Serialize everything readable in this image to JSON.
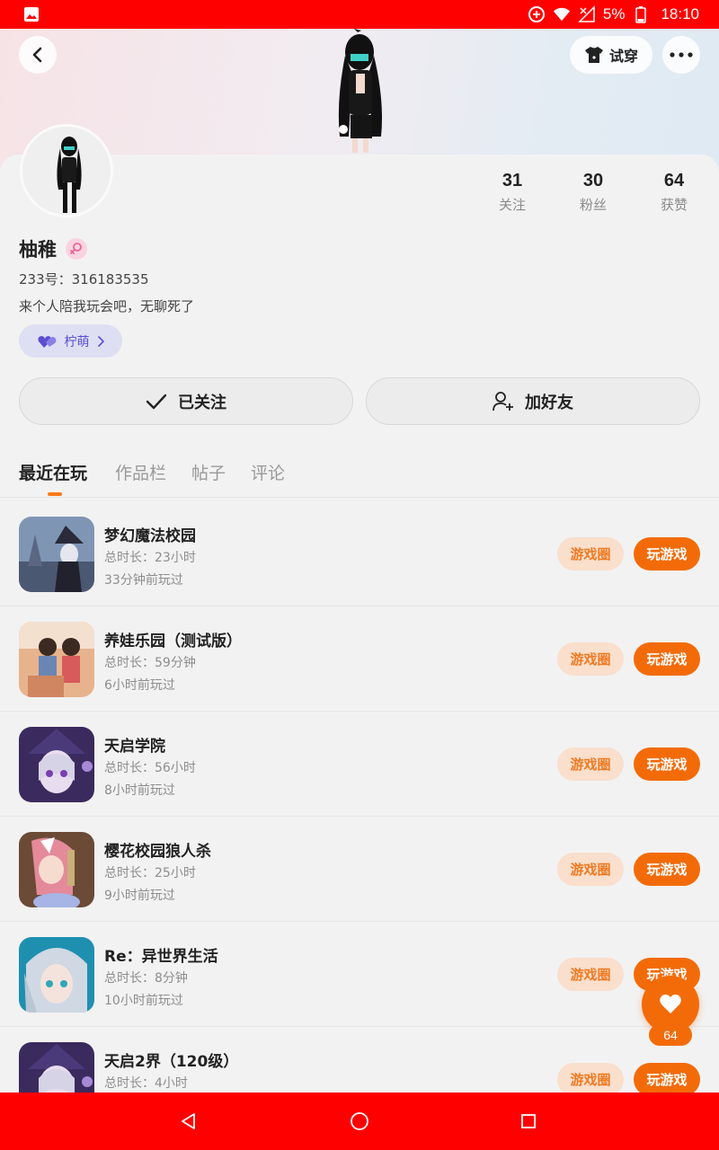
{
  "status_bar": {
    "battery": "5%",
    "time": "18:10"
  },
  "header": {
    "tryon_label": "试穿"
  },
  "profile": {
    "stats": [
      {
        "num": "31",
        "label": "关注"
      },
      {
        "num": "30",
        "label": "粉丝"
      },
      {
        "num": "64",
        "label": "获赞"
      }
    ],
    "nickname": "柚稚",
    "uid": "233号：316183535",
    "bio": "来个人陪我玩会吧，无聊死了",
    "tag": "柠萌",
    "follow_label": "已关注",
    "add_friend_label": "加好友"
  },
  "tabs": [
    "最近在玩",
    "作品栏",
    "帖子",
    "评论"
  ],
  "games": [
    {
      "name": "梦幻魔法校园",
      "duration": "总时长：23小时",
      "last": "33分钟前玩过"
    },
    {
      "name": "养娃乐园（测试版）",
      "duration": "总时长：59分钟",
      "last": "6小时前玩过"
    },
    {
      "name": "天启学院",
      "duration": "总时长：56小时",
      "last": "8小时前玩过"
    },
    {
      "name": "樱花校园狼人杀",
      "duration": "总时长：25小时",
      "last": "9小时前玩过"
    },
    {
      "name": "Re：异世界生活",
      "duration": "总时长：8分钟",
      "last": "10小时前玩过"
    },
    {
      "name": "天启2界（120级）",
      "duration": "总时长：4小时",
      "last": ""
    }
  ],
  "game_buttons": {
    "circle": "游戏圈",
    "play": "玩游戏"
  },
  "float_like": {
    "count": "64"
  },
  "colors": {
    "accent": "#f36b09",
    "status_bar": "#ff0000",
    "tag_text": "#5a4ed1"
  }
}
